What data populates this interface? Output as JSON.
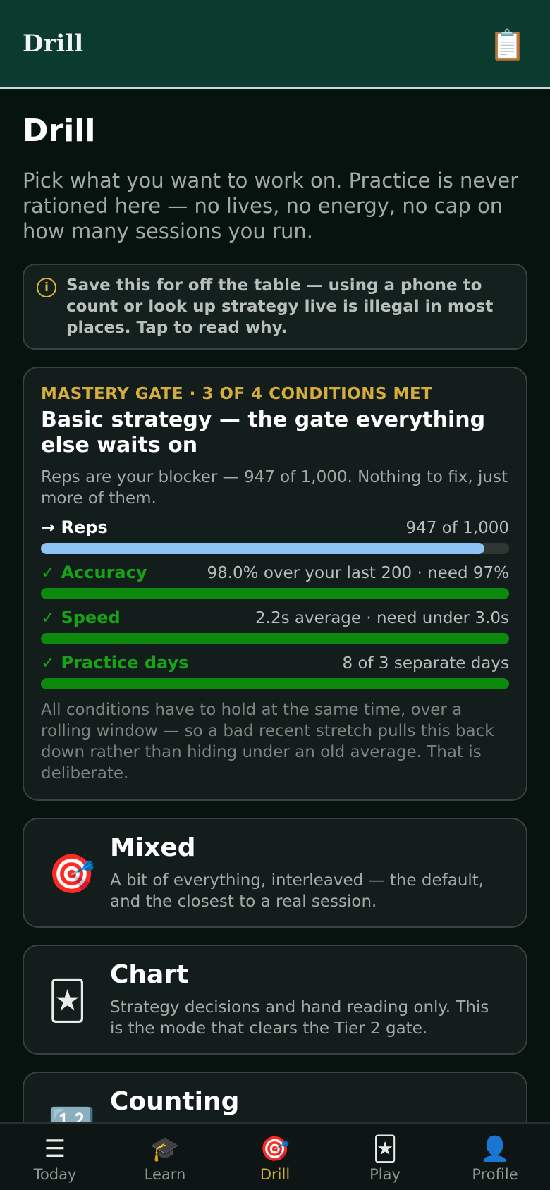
{
  "header": {
    "title": "Drill",
    "icon": "clipboard-icon"
  },
  "page": {
    "title": "Drill",
    "intro": "Pick what you want to work on. Practice is never rationed here — no lives, no energy, no cap on how many sessions you run."
  },
  "notice": {
    "icon": "info-icon",
    "icon_glyph": "i",
    "text": "Save this for off the table — using a phone to count or look up strategy live is illegal in most places. Tap to read why."
  },
  "gate": {
    "kicker": "MASTERY GATE · 3 OF 4 CONDITIONS MET",
    "title": "Basic strategy — the gate everything else waits on",
    "subtitle": "Reps are your blocker — 947 of 1,000. Nothing to fix, just more of them.",
    "conditions": [
      {
        "label": "→ Reps",
        "value": "947 of 1,000",
        "progress": 0.947,
        "status": "blocker",
        "color": "#8ec3f5",
        "label_color": "#ffffff"
      },
      {
        "label": "✓ Accuracy",
        "value": "98.0% over your last 200 · need 97%",
        "progress": 1.0,
        "status": "met",
        "color": "#0d8a0d",
        "label_color": "#17a317"
      },
      {
        "label": "✓ Speed",
        "value": "2.2s average · need under 3.0s",
        "progress": 1.0,
        "status": "met",
        "color": "#0d8a0d",
        "label_color": "#17a317"
      },
      {
        "label": "✓ Practice days",
        "value": "8 of 3 separate days",
        "progress": 1.0,
        "status": "met",
        "color": "#0d8a0d",
        "label_color": "#17a317"
      }
    ],
    "note": "All conditions have to hold at the same time, over a rolling window — so a bad recent stretch pulls this back down rather than hiding under an old average. That is deliberate."
  },
  "modes": [
    {
      "title": "Mixed",
      "icon": "target-icon",
      "glyph": "🎯",
      "description": "A bit of everything, interleaved — the default, and the closest to a real session."
    },
    {
      "title": "Chart",
      "icon": "joker-card-icon",
      "glyph": "🃏",
      "description": "Strategy decisions and hand reading only. This is the mode that clears the Tier 2 gate."
    },
    {
      "title": "Counting",
      "icon": "numbers-icon",
      "glyph": "🔢",
      "description": ""
    }
  ],
  "tabs": [
    {
      "label": "Today",
      "icon": "list-icon",
      "glyph": "☰",
      "active": false
    },
    {
      "label": "Learn",
      "icon": "graduation-cap-icon",
      "glyph": "🎓",
      "active": false
    },
    {
      "label": "Drill",
      "icon": "target-icon",
      "glyph": "🎯",
      "active": true
    },
    {
      "label": "Play",
      "icon": "joker-card-icon",
      "glyph": "🃏",
      "active": false
    },
    {
      "label": "Profile",
      "icon": "user-icon",
      "glyph": "👤",
      "active": false
    }
  ],
  "colors": {
    "header_bg": "#0b3a2e",
    "accent": "#d4ad3c",
    "met": "#0d8a0d",
    "blocker": "#8ec3f5",
    "background": "#06130f"
  }
}
